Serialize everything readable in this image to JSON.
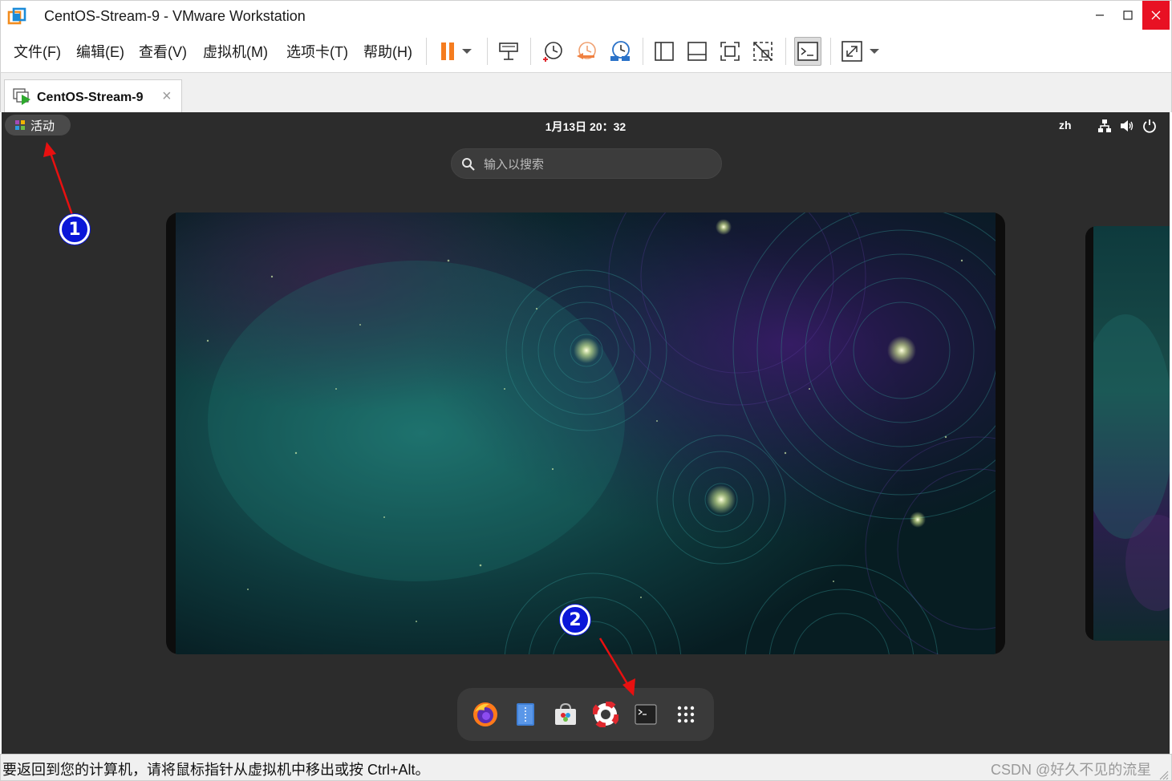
{
  "window": {
    "title": "CentOS-Stream-9 - VMware Workstation"
  },
  "menu": {
    "file": "文件(F)",
    "edit": "编辑(E)",
    "view": "查看(V)",
    "vm": "虚拟机(M)",
    "tabs": "选项卡(T)",
    "help": "帮助(H)"
  },
  "toolbar": {
    "icons": [
      "pause-icon",
      "dropdown-icon",
      "send-ctrl-alt-del-icon",
      "snapshot-icon",
      "revert-snapshot-icon",
      "snapshot-manager-icon",
      "library-view-icon",
      "thumbnail-view-icon",
      "fullscreen-icon",
      "unity-icon",
      "console-view-icon",
      "stretch-icon",
      "dropdown-icon"
    ]
  },
  "tab": {
    "label": "CentOS-Stream-9"
  },
  "guest": {
    "activities_label": "活动",
    "clock": "1月13日  20：32",
    "lang": "zh",
    "search_placeholder": "输入以搜索",
    "dash_apps": [
      "firefox-icon",
      "text-editor-icon",
      "software-center-icon",
      "help-icon",
      "terminal-icon",
      "show-apps-icon"
    ]
  },
  "annotations": {
    "callout_1": "1",
    "callout_2": "2"
  },
  "status": {
    "text": "要返回到您的计算机，请将鼠标指针从虚拟机中移出或按 Ctrl+Alt。",
    "watermark": "CSDN @好久不见的流星"
  },
  "colors": {
    "close_button": "#e81123",
    "guest_bg": "#2c2c2c",
    "callout": "#0a16d8",
    "arrow": "#e81010",
    "pause_orange": "#f57c1f"
  }
}
